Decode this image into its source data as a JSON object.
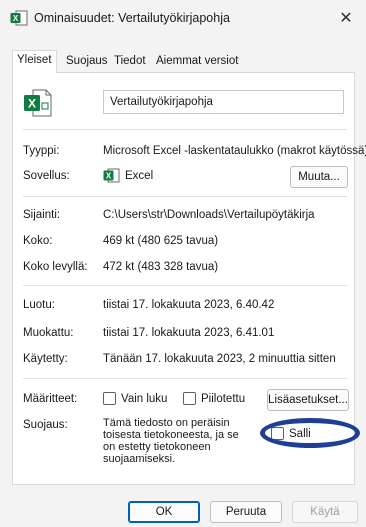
{
  "window": {
    "title": "Ominaisuudet: Vertailutyökirjapohja",
    "close_glyph": "✕"
  },
  "tabs": [
    {
      "label": "Yleiset",
      "active": true
    },
    {
      "label": "Suojaus",
      "active": false
    },
    {
      "label": "Tiedot",
      "active": false
    },
    {
      "label": "Aiemmat versiot",
      "active": false
    }
  ],
  "general": {
    "file_name": "Vertailutyökirjapohja",
    "type_label": "Tyyppi:",
    "type_value": "Microsoft Excel -laskentataulukko (makrot käytössä)",
    "app_label": "Sovellus:",
    "app_value": "Excel",
    "change_button": "Muuta...",
    "location_label": "Sijainti:",
    "location_value": "C:\\Users\\str\\Downloads\\Vertailupöytäkirja",
    "size_label": "Koko:",
    "size_value": "469 kt (480 625 tavua)",
    "size_on_disk_label": "Koko levyllä:",
    "size_on_disk_value": "472 kt (483 328 tavua)",
    "created_label": "Luotu:",
    "created_value": "tiistai 17. lokakuuta 2023, 6.40.42",
    "modified_label": "Muokattu:",
    "modified_value": "tiistai 17. lokakuuta 2023, 6.41.01",
    "accessed_label": "Käytetty:",
    "accessed_value": "Tänään 17. lokakuuta 2023, 2 minuuttia sitten",
    "attributes_label": "Määritteet:",
    "readonly_label": "Vain luku",
    "hidden_label": "Piilotettu",
    "advanced_button": "Lisäasetukset...",
    "security_label": "Suojaus:",
    "security_text": "Tämä tiedosto on peräisin toisesta tietokoneesta, ja se on estetty tietokoneen suojaamiseksi.",
    "unblock_label": "Salli"
  },
  "footer": {
    "ok": "OK",
    "cancel": "Peruuta",
    "apply": "Käytä"
  },
  "colors": {
    "excel_green": "#107c41",
    "annotation_oval": "#1f3f94"
  }
}
